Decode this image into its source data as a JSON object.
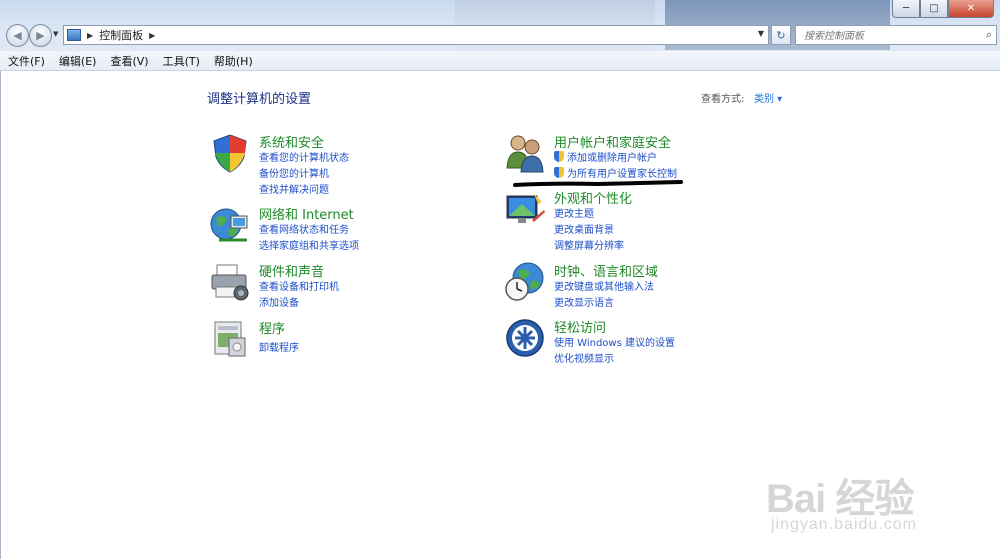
{
  "window": {
    "min_glyph": "─",
    "max_glyph": "□",
    "close_glyph": "✕"
  },
  "address_bar": {
    "crumb": "控制面板",
    "search_placeholder": "搜索控制面板"
  },
  "menu": [
    "文件(F)",
    "编辑(E)",
    "查看(V)",
    "工具(T)",
    "帮助(H)"
  ],
  "page": {
    "title": "调整计算机的设置",
    "view_by_label": "查看方式:",
    "view_by_value": "类别 ▾"
  },
  "categories": {
    "system": {
      "title": "系统和安全",
      "links": [
        "查看您的计算机状态",
        "备份您的计算机",
        "查找并解决问题"
      ]
    },
    "network": {
      "title": "网络和 Internet",
      "links": [
        "查看网络状态和任务",
        "选择家庭组和共享选项"
      ]
    },
    "hardware": {
      "title": "硬件和声音",
      "links": [
        "查看设备和打印机",
        "添加设备"
      ]
    },
    "programs": {
      "title": "程序",
      "links": [
        "卸载程序"
      ]
    },
    "users": {
      "title": "用户帐户和家庭安全",
      "links": [
        "添加或删除用户帐户",
        "为所有用户设置家长控制"
      ]
    },
    "appearance": {
      "title": "外观和个性化",
      "links": [
        "更改主题",
        "更改桌面背景",
        "调整屏幕分辨率"
      ]
    },
    "clock": {
      "title": "时钟、语言和区域",
      "links": [
        "更改键盘或其他输入法",
        "更改显示语言"
      ]
    },
    "ease": {
      "title": "轻松访问",
      "links": [
        "使用 Windows 建议的设置",
        "优化视频显示"
      ]
    }
  },
  "watermark": {
    "brand": "Bai 经验",
    "sub": "jingyan.baidu.com"
  }
}
